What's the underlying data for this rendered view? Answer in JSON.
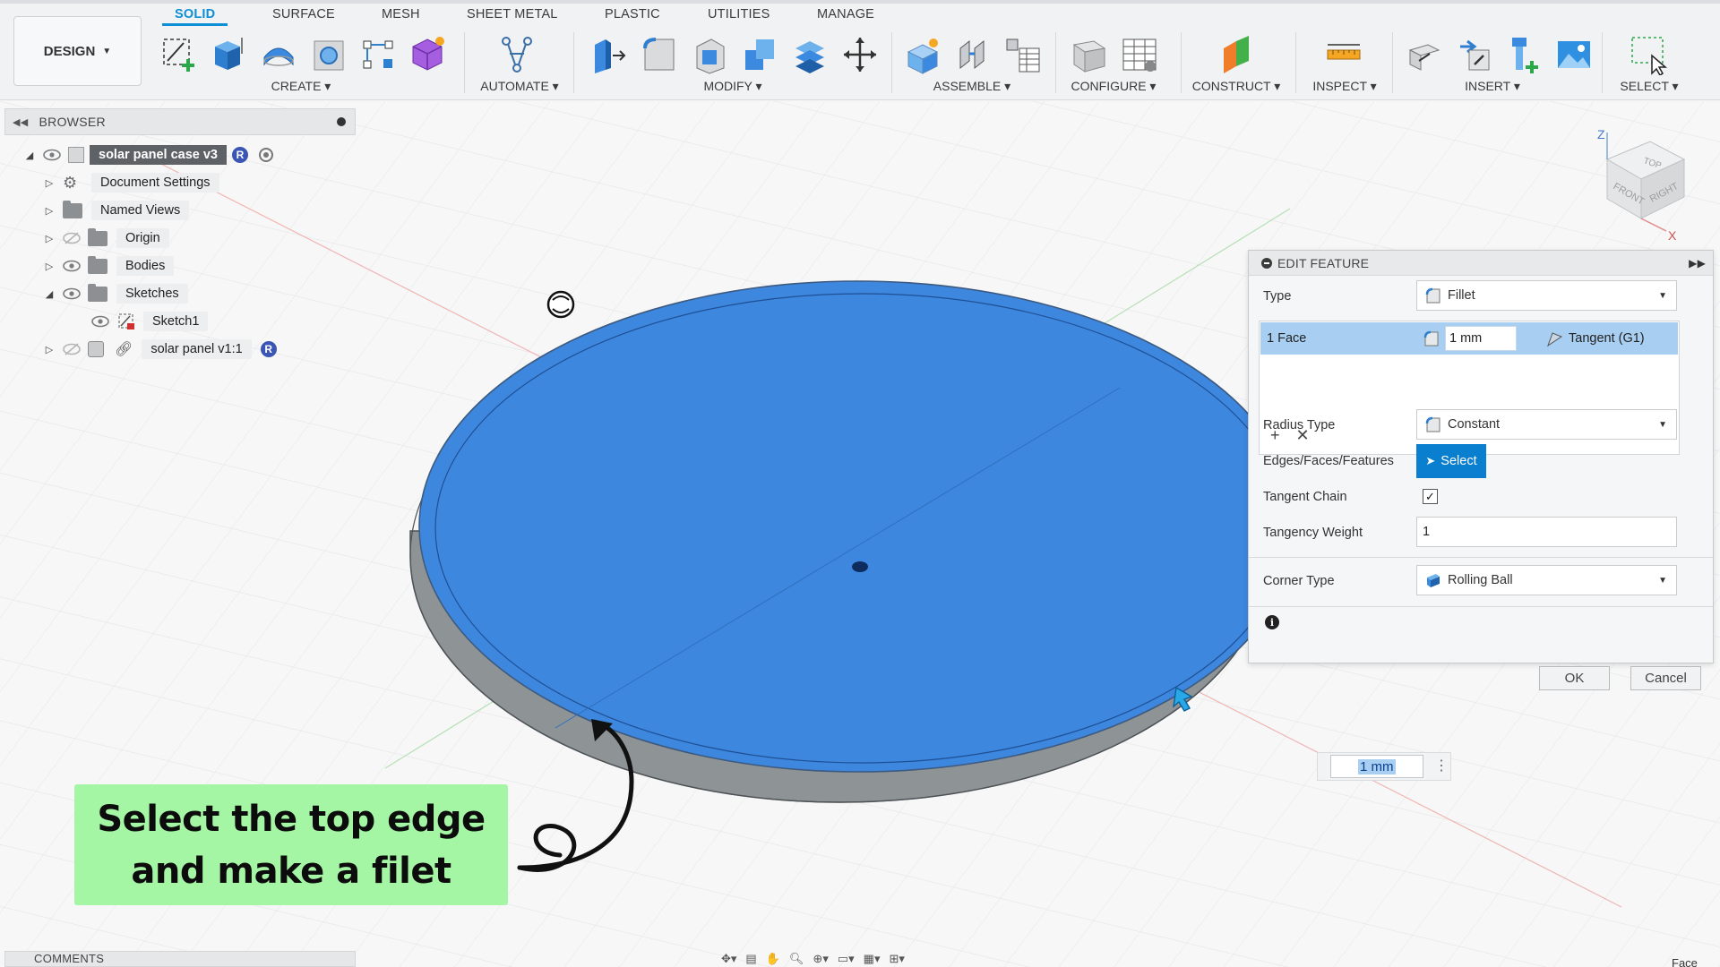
{
  "tabs": [
    "SOLID",
    "SURFACE",
    "MESH",
    "SHEET METAL",
    "PLASTIC",
    "UTILITIES",
    "MANAGE"
  ],
  "workspace": "DESIGN",
  "groups": {
    "create": "CREATE ▾",
    "automate": "AUTOMATE ▾",
    "modify": "MODIFY ▾",
    "assemble": "ASSEMBLE ▾",
    "configure": "CONFIGURE ▾",
    "construct": "CONSTRUCT ▾",
    "inspect": "INSPECT ▾",
    "insert": "INSERT ▾",
    "select": "SELECT ▾"
  },
  "browser": {
    "title": "BROWSER",
    "root": "solar panel case v3",
    "items": {
      "doc_settings": "Document Settings",
      "named_views": "Named Views",
      "origin": "Origin",
      "bodies": "Bodies",
      "sketches": "Sketches",
      "sketch1": "Sketch1",
      "component": "solar panel v1:1"
    },
    "badge": "R"
  },
  "dialog": {
    "title": "EDIT FEATURE",
    "type_label": "Type",
    "type_value": "Fillet",
    "selection_row": {
      "name": "1 Face",
      "radius": "1 mm",
      "continuity": "Tangent (G1)"
    },
    "radius_type_label": "Radius Type",
    "radius_type_value": "Constant",
    "edges_label": "Edges/Faces/Features",
    "select_label": "Select",
    "tangent_chain_label": "Tangent Chain",
    "tangent_chain_checked": true,
    "tangency_weight_label": "Tangency Weight",
    "tangency_weight_value": "1",
    "corner_type_label": "Corner Type",
    "corner_type_value": "Rolling Ball",
    "ok_label": "OK",
    "cancel_label": "Cancel"
  },
  "float_input": "1 mm",
  "callout": {
    "line1": "Select the top edge",
    "line2": "and make a filet"
  },
  "comments": "COMMENTS",
  "tail_text": "Face",
  "viewcube": {
    "top": "TOP",
    "front": "FRONT",
    "right": "RIGHT",
    "axis_z": "Z",
    "axis_x": "X"
  },
  "colors": {
    "accent": "#0d8fd6",
    "face_blue": "#3d87de",
    "select_blue": "#0a7fcf",
    "callout_green": "#a4f5a4"
  }
}
